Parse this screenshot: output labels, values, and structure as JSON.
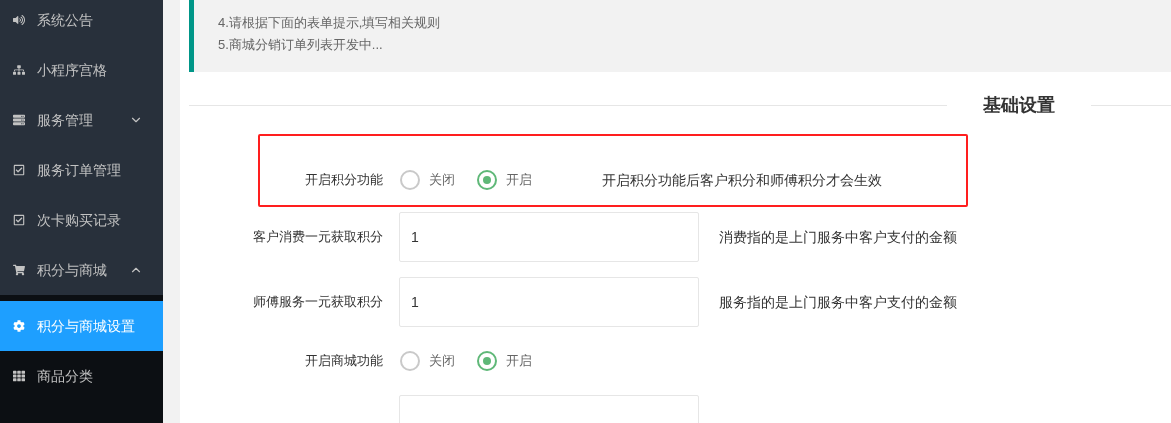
{
  "sidebar": {
    "items": [
      {
        "label": "系统公告",
        "selected": false
      },
      {
        "label": "小程序宫格",
        "selected": false
      },
      {
        "label": "服务管理",
        "selected": false,
        "expanded": false
      },
      {
        "label": "服务订单管理",
        "selected": false
      },
      {
        "label": "次卡购买记录",
        "selected": false
      },
      {
        "label": "积分与商城",
        "selected": false,
        "expanded": true,
        "children": [
          {
            "label": "积分与商城设置",
            "selected": true
          },
          {
            "label": "商品分类",
            "selected": false
          }
        ]
      }
    ]
  },
  "notice": {
    "lines": [
      "4.请根据下面的表单提示,填写相关规则",
      "5.商城分销订单列表开发中..."
    ]
  },
  "section_title": "基础设置",
  "form": {
    "rows": [
      {
        "kind": "radio",
        "label": "开启积分功能",
        "highlighted": true,
        "options": [
          {
            "label": "关闭",
            "selected": false
          },
          {
            "label": "开启",
            "selected": true
          }
        ],
        "hint": "开启积分功能后客户积分和师傅积分才会生效"
      },
      {
        "kind": "input",
        "label": "客户消费一元获取积分",
        "value": "1",
        "hint": "消费指的是上门服务中客户支付的金额"
      },
      {
        "kind": "input",
        "label": "师傅服务一元获取积分",
        "value": "1",
        "hint": "服务指的是上门服务中客户支付的金额"
      },
      {
        "kind": "radio",
        "label": "开启商城功能",
        "highlighted": false,
        "options": [
          {
            "label": "关闭",
            "selected": false
          },
          {
            "label": "开启",
            "selected": true
          }
        ]
      },
      {
        "kind": "input"
      }
    ]
  }
}
